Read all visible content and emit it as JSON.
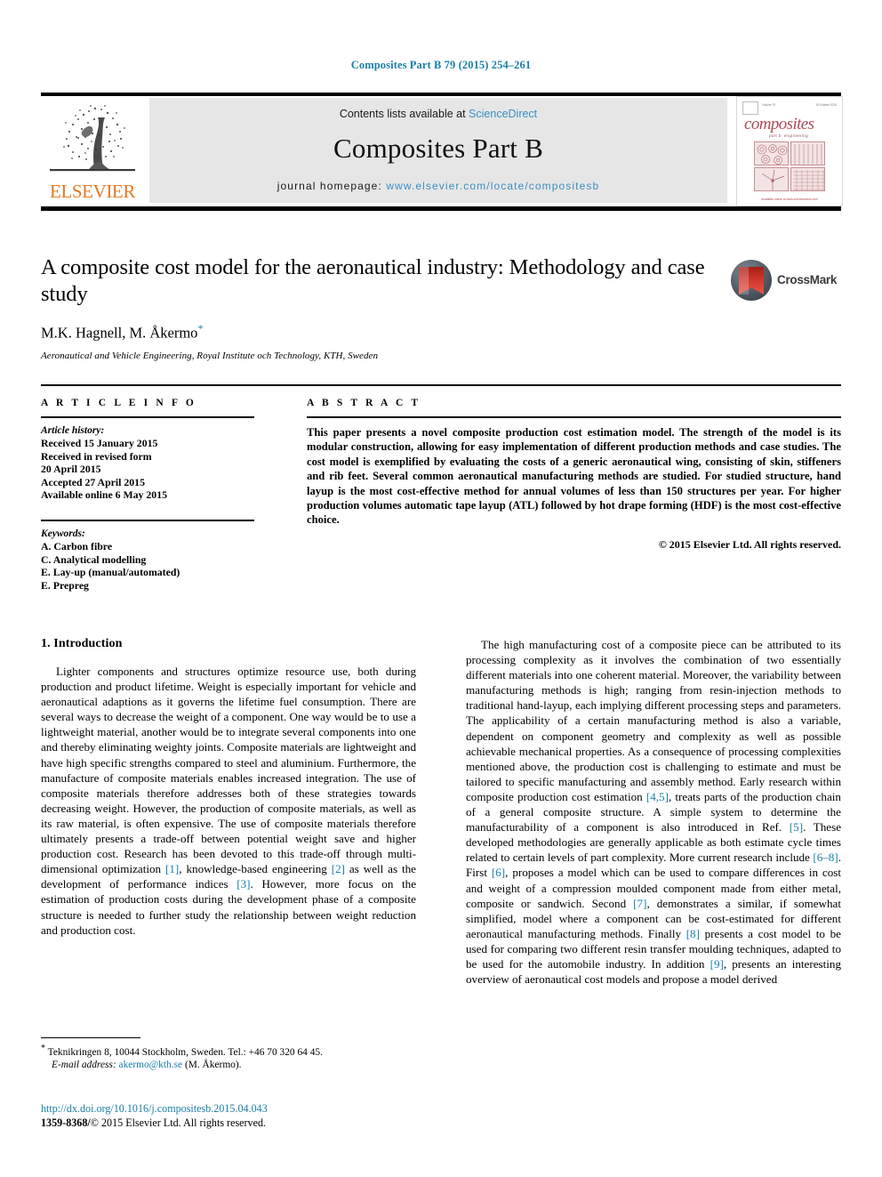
{
  "running_head": "Composites Part B 79 (2015) 254–261",
  "masthead": {
    "contents_prefix": "Contents lists available at ",
    "sciencedirect": "ScienceDirect",
    "journal_title": "Composites Part B",
    "homepage_label": "journal homepage: ",
    "homepage_url": "www.elsevier.com/locate/compositesb",
    "publisher_word": "ELSEVIER",
    "publisher_color": "#E87722",
    "link_color": "#3b8ec2",
    "cover": {
      "title_word": "composites",
      "subtitle": "part b: engineering",
      "top_left_label": "ELSEVIER",
      "top_center_label": "Volume 79",
      "top_right_label": "15 October 2015",
      "footer": "Available online at www.sciencedirect.com"
    }
  },
  "article": {
    "title": "A composite cost model for the aeronautical industry: Methodology and case study",
    "authors": "M.K. Hagnell, M. Åkermo",
    "corresponding_marker": "*",
    "affiliation": "Aeronautical and Vehicle Engineering, Royal Institute och Technology, KTH, Sweden",
    "crossmark_label": "CrossMark"
  },
  "info": {
    "heading": "A R T I C L E   I N F O",
    "history_label": "Article history:",
    "history": [
      "Received 15 January 2015",
      "Received in revised form",
      "20 April 2015",
      "Accepted 27 April 2015",
      "Available online 6 May 2015"
    ],
    "keywords_label": "Keywords:",
    "keywords": [
      "A. Carbon fibre",
      "C. Analytical modelling",
      "E. Lay-up (manual/automated)",
      "E. Prepreg"
    ]
  },
  "abstract": {
    "heading": "A B S T R A C T",
    "text": "This paper presents a novel composite production cost estimation model. The strength of the model is its modular construction, allowing for easy implementation of different production methods and case studies. The cost model is exemplified by evaluating the costs of a generic aeronautical wing, consisting of skin, stiffeners and rib feet. Several common aeronautical manufacturing methods are studied. For studied structure, hand layup is the most cost-effective method for annual volumes of less than 150 structures per year. For higher production volumes automatic tape layup (ATL) followed by hot drape forming (HDF) is the most cost-effective choice.",
    "copyright": "© 2015 Elsevier Ltd. All rights reserved."
  },
  "body": {
    "section_title": "1. Introduction",
    "left_paragraph_1": "Lighter components and structures optimize resource use, both during production and product lifetime. Weight is especially important for vehicle and aeronautical adaptions as it governs the lifetime fuel consumption. There are several ways to decrease the weight of a component. One way would be to use a lightweight material, another would be to integrate several components into one and thereby eliminating weighty joints. Composite materials are lightweight and have high specific strengths compared to steel and aluminium. Furthermore, the manufacture of composite materials enables increased integration. The use of composite materials therefore addresses both of these strategies towards decreasing weight. However, the production of composite materials, as well as its raw material, is often expensive. The use of composite materials therefore ultimately presents a trade-off between potential weight save and higher production cost. Research has been devoted to this trade-off through multi-dimensional optimization ",
    "left_ref_1": "[1]",
    "left_paragraph_1b": ", knowledge-based engineering ",
    "left_ref_2": "[2]",
    "left_paragraph_1c": " as well as the development of performance indices ",
    "left_ref_3": "[3]",
    "left_paragraph_1d": ". However, more focus on the estimation of production costs during the development phase of a composite structure is needed to further study the relationship between weight reduction and production cost.",
    "right_paragraph_1": "The high manufacturing cost of a composite piece can be attributed to its processing complexity as it involves the combination of two essentially different materials into one coherent material. Moreover, the variability between manufacturing methods is high; ranging from resin-injection methods to traditional hand-layup, each implying different processing steps and parameters. The applicability of a certain manufacturing method is also a variable, dependent on component geometry and complexity as well as possible achievable mechanical properties. As a consequence of processing complexities mentioned above, the production cost is challenging to estimate and must be tailored to specific manufacturing and assembly method. Early research within composite production cost estimation ",
    "right_ref_1": "[4,5]",
    "right_paragraph_1b": ", treats parts of the production chain of a general composite structure. A simple system to determine the manufacturability of a component is also introduced in Ref. ",
    "right_ref_2": "[5]",
    "right_paragraph_1c": ". These developed methodologies are generally applicable as both estimate cycle times related to certain levels of part complexity. More current research include ",
    "right_ref_3": "[6–8]",
    "right_paragraph_1d": ". First ",
    "right_ref_4": "[6]",
    "right_paragraph_1e": ", proposes a model which can be used to compare differences in cost and weight of a compression moulded component made from either metal, composite or sandwich. Second ",
    "right_ref_5": "[7]",
    "right_paragraph_1f": ", demonstrates a similar, if somewhat simplified, model where a component can be cost-estimated for different aeronautical manufacturing methods. Finally ",
    "right_ref_6": "[8]",
    "right_paragraph_1g": " presents a cost model to be used for comparing two different resin transfer moulding techniques, adapted to be used for the automobile industry. In addition ",
    "right_ref_7": "[9]",
    "right_paragraph_1h": ", presents an interesting overview of aeronautical cost models and propose a model derived"
  },
  "footer": {
    "corresponding_marker": "*",
    "corresponding_text": "Teknikringen 8, 10044 Stockholm, Sweden. Tel.: +46 70 320 64 45.",
    "email_label": "E-mail address:",
    "email": "akermo@kth.se",
    "email_suffix": "(M. Åkermo).",
    "doi": "http://dx.doi.org/10.1016/j.compositesb.2015.04.043",
    "issn_line_prefix": "1359-8368/",
    "issn_line_rest": "© 2015 Elsevier Ltd. All rights reserved."
  }
}
